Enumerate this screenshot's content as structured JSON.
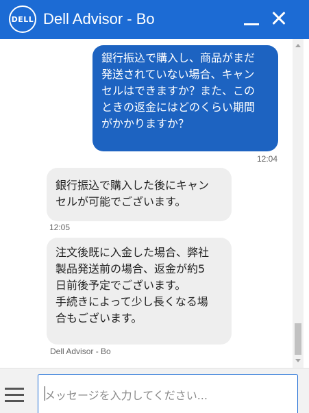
{
  "header": {
    "logo_text": "DELL",
    "title": "Dell Advisor - Bo",
    "accent_color": "#1c6bd4",
    "icons": [
      "minimize-icon",
      "close-icon"
    ]
  },
  "messages": [
    {
      "from": "user",
      "text": "銀行振込で購入し、商品がまだ\n発送されていない場合、キャン\nセルはできますか？また、この\nときの返金にはどのくらい期間\nがかかりますか？",
      "time": "12:04"
    },
    {
      "from": "agent",
      "text": "銀行振込で購入した後にキャン\nセルが可能でございます。",
      "time": "12:05"
    },
    {
      "from": "agent",
      "text": "注文後既に入金した場合、弊社\n製品発送前の場合、返金が約5\n日前後予定でございます。\n手続きによって少し長くなる場\n合もございます。",
      "sender": "Dell Advisor - Bo"
    }
  ],
  "composer": {
    "placeholder": "メッセージを入力してください...",
    "value": "",
    "menu_icon": "hamburger-menu-icon"
  }
}
